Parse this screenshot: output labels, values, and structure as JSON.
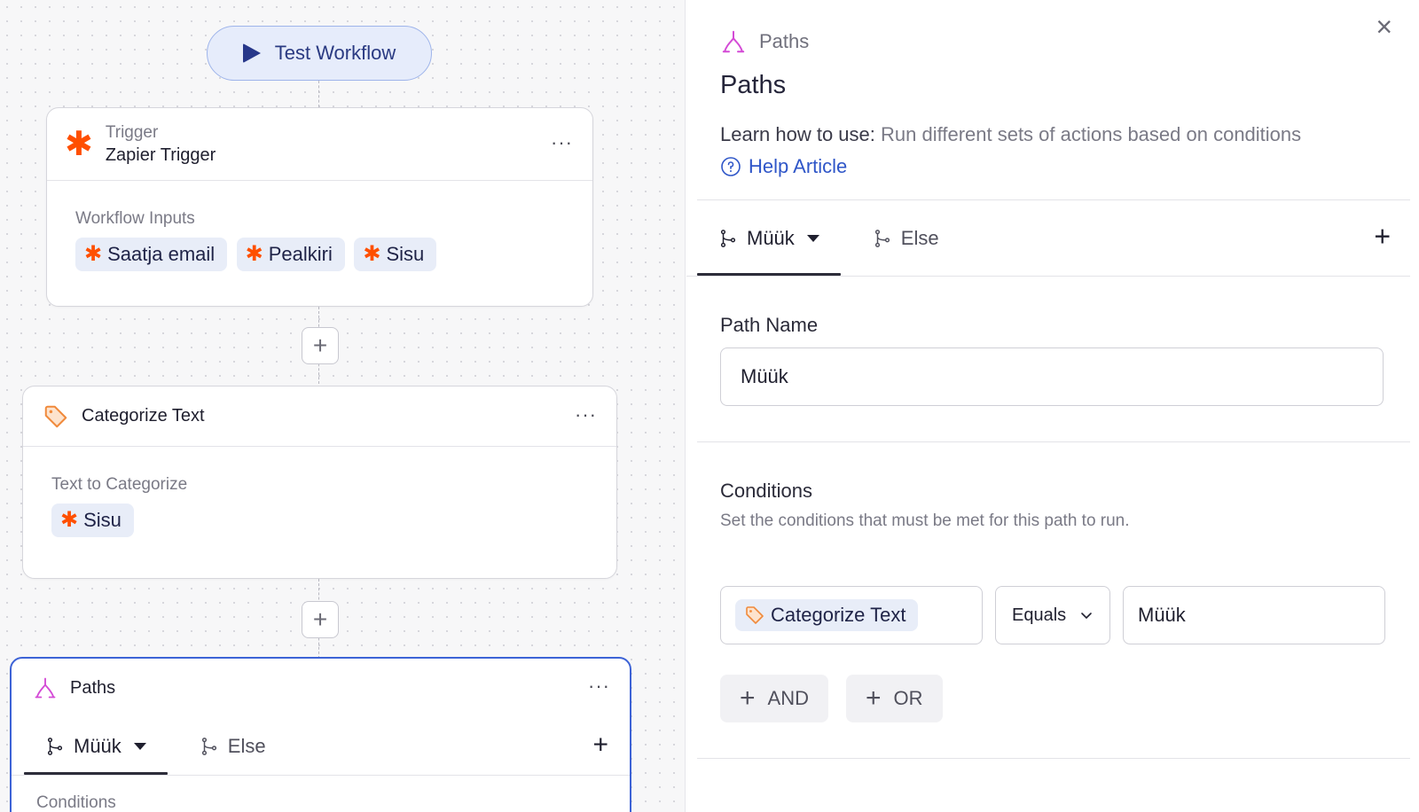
{
  "canvas": {
    "test_button": "Test Workflow",
    "trigger_node": {
      "kind": "Trigger",
      "title": "Zapier Trigger",
      "inputs_label": "Workflow Inputs",
      "chips": [
        "Saatja email",
        "Pealkiri",
        "Sisu"
      ]
    },
    "categorize_node": {
      "title": "Categorize Text",
      "field_label": "Text to Categorize",
      "chip": "Sisu"
    },
    "paths_node": {
      "title": "Paths",
      "tab_active": "Müük",
      "tab_else": "Else",
      "section_label": "Conditions"
    },
    "more_glyph": "···",
    "plus_glyph": "+"
  },
  "panel": {
    "breadcrumb": "Paths",
    "title": "Paths",
    "learn_prefix": "Learn how to use:",
    "learn_text": "Run different sets of actions based on conditions",
    "help_link": "Help Article",
    "close_glyph": "×",
    "tab_active": "Müük",
    "tab_else": "Else",
    "add_tab_glyph": "+",
    "path_name_label": "Path Name",
    "path_name_value": "Müük",
    "conditions_title": "Conditions",
    "conditions_desc": "Set the conditions that must be met for this path to run.",
    "condition": {
      "field": "Categorize Text",
      "operator": "Equals",
      "value": "Müük"
    },
    "and_label": "AND",
    "or_label": "OR"
  },
  "colors": {
    "zapier_orange": "#ff4f00",
    "link_blue": "#2f56c8",
    "selected_border": "#3d63d6",
    "paths_pink": "#d44bd6",
    "tag_orange": "#f08a3c"
  },
  "icons": {
    "play": "play-icon",
    "zapier": "zapier-asterisk-icon",
    "tag": "tag-icon",
    "paths": "paths-icon",
    "branch": "branch-icon",
    "help": "help-circle-icon",
    "close": "close-icon",
    "chevron": "chevron-down-icon"
  }
}
